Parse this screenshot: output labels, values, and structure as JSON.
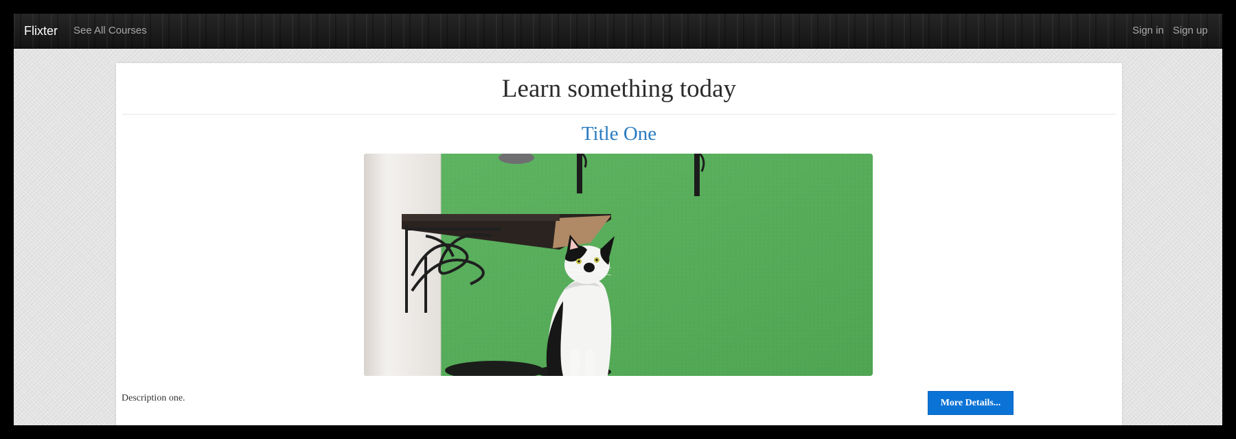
{
  "navbar": {
    "brand": "Flixter",
    "links": {
      "courses": "See All Courses",
      "sign_in": "Sign in",
      "sign_up": "Sign up"
    }
  },
  "main": {
    "heading": "Learn something today",
    "course": {
      "title": "Title One",
      "description": "Description one.",
      "details_button": "More Details..."
    }
  },
  "colors": {
    "link_blue": "#2a7bc0",
    "button_blue": "#0b73d6",
    "wall_green": "#5bb35d"
  }
}
